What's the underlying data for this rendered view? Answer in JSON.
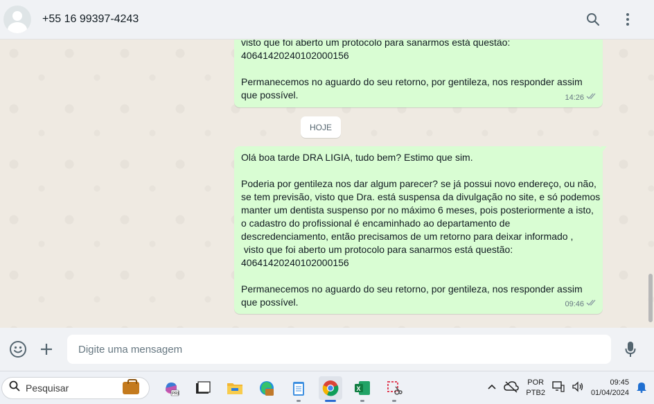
{
  "header": {
    "contact_name": "+55 16 99397-4243",
    "icons": [
      "search-icon",
      "menu-icon"
    ]
  },
  "messages": [
    {
      "lines": [
        "visto que foi aberto um protocolo para sanarmos está questão:",
        "40641420240102000156",
        "",
        "Permanecemos no aguardo do seu retorno, por gentileza, nos responder assim",
        "que possível."
      ],
      "time": "14:26"
    },
    {
      "lines": [
        "Olá boa tarde DRA LIGIA, tudo bem? Estimo que sim.",
        "",
        "Poderia por gentileza nos dar algum parecer? se já possui novo endereço, ou não,",
        "se tem previsão, visto que Dra. está suspensa da divulgação no site, e só podemos",
        "manter um dentista suspenso por no máximo 6 meses, pois posteriormente a isto,",
        "o cadastro do profissional é encaminhado ao departamento de",
        "descredenciamento, então precisamos de um retorno para deixar informado ,",
        " visto que foi aberto um protocolo para sanarmos está questão:",
        "40641420240102000156",
        "",
        "Permanecemos no aguardo do seu retorno, por gentileza, nos responder assim",
        "que possível."
      ],
      "time": "09:46"
    }
  ],
  "date_chip": "HOJE",
  "compose": {
    "placeholder": "Digite uma mensagem"
  },
  "taskbar": {
    "search_label": "Pesquisar",
    "apps": [
      "copilot-icon",
      "terminal-icon",
      "file-explorer-icon",
      "edge-icon",
      "notepad-icon",
      "chrome-icon",
      "excel-icon",
      "snipping-tool-icon"
    ],
    "lang_line1": "POR",
    "lang_line2": "PTB2",
    "time": "09:45",
    "date": "01/04/2024"
  },
  "colors": {
    "bubble_out": "#d9fdd3",
    "chat_bg": "#efeae2",
    "header_bg": "#f0f2f5",
    "tick_read": "#8696a0"
  }
}
